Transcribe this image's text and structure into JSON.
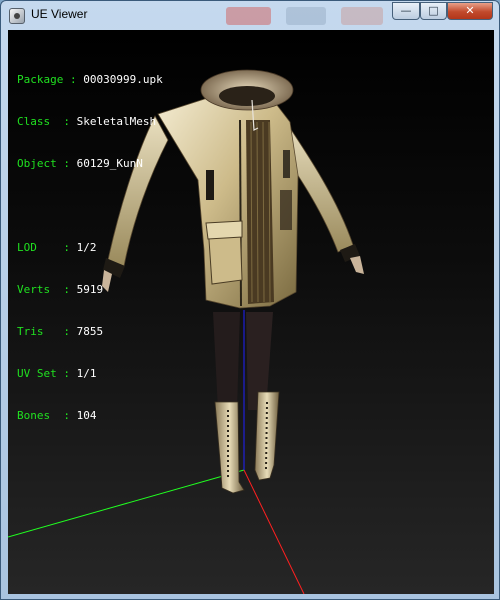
{
  "window": {
    "title": "UE Viewer",
    "controls": {
      "minimize": "—",
      "maximize": "□",
      "close": "✕"
    }
  },
  "info_panel": {
    "object_rows": [
      {
        "label": "Package",
        "sep": " : ",
        "value": "00030999.upk"
      },
      {
        "label": "Class  ",
        "sep": ": ",
        "value": "SkeletalMesh"
      },
      {
        "label": "Object ",
        "sep": ": ",
        "value": "60129_KunN"
      }
    ],
    "mesh_rows": [
      {
        "label": "LOD    ",
        "sep": ": ",
        "value": "1/2"
      },
      {
        "label": "Verts  ",
        "sep": ": ",
        "value": "5919"
      },
      {
        "label": "Tris   ",
        "sep": ": ",
        "value": "7855"
      },
      {
        "label": "UV Set ",
        "sep": ": ",
        "value": "1/1"
      },
      {
        "label": "Bones  ",
        "sep": ": ",
        "value": "104"
      }
    ]
  },
  "colors": {
    "label": "#20e020",
    "value": "#ffffff",
    "axis_x": "#ff2020",
    "axis_y": "#20ff20",
    "axis_z": "#2020ff"
  }
}
